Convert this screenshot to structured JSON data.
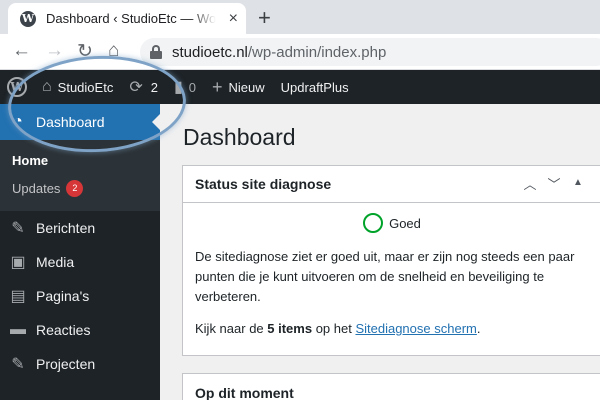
{
  "browser": {
    "tab_title": "Dashboard ‹ StudioEtc — WordPress",
    "new_tab": "+",
    "close": "×",
    "url_domain": "studioetc.nl",
    "url_path": "/wp-admin/index.php"
  },
  "adminbar": {
    "site_name": "StudioEtc",
    "updates_count": "2",
    "comments_count": "0",
    "new_label": "Nieuw",
    "plugin_label": "UpdraftPlus"
  },
  "sidebar": {
    "dashboard_label": "Dashboard",
    "home_label": "Home",
    "updates_label": "Updates",
    "updates_badge": "2",
    "items": [
      {
        "label": "Berichten",
        "icon": "pin-icon"
      },
      {
        "label": "Media",
        "icon": "media-icon"
      },
      {
        "label": "Pagina's",
        "icon": "page-icon"
      },
      {
        "label": "Reacties",
        "icon": "comment-icon"
      },
      {
        "label": "Projecten",
        "icon": "pin-icon"
      }
    ]
  },
  "main": {
    "page_title": "Dashboard",
    "health": {
      "title": "Status site diagnose",
      "status": "Goed",
      "description": "De sitediagnose ziet er goed uit, maar er zijn nog steeds een paar punten die je kunt uitvoeren om de snelheid en beveiliging te verbeteren.",
      "items_prefix": "Kijk naar de ",
      "items_bold": "5 items",
      "items_mid": " op het ",
      "items_link": "Sitediagnose scherm",
      "items_suffix": "."
    },
    "glance": {
      "title": "Op dit moment"
    }
  },
  "colors": {
    "admin_bar": "#1d2327",
    "accent": "#2271b1",
    "badge": "#d63638",
    "health_good": "#00a32a",
    "highlight": "#7fa3c7"
  }
}
